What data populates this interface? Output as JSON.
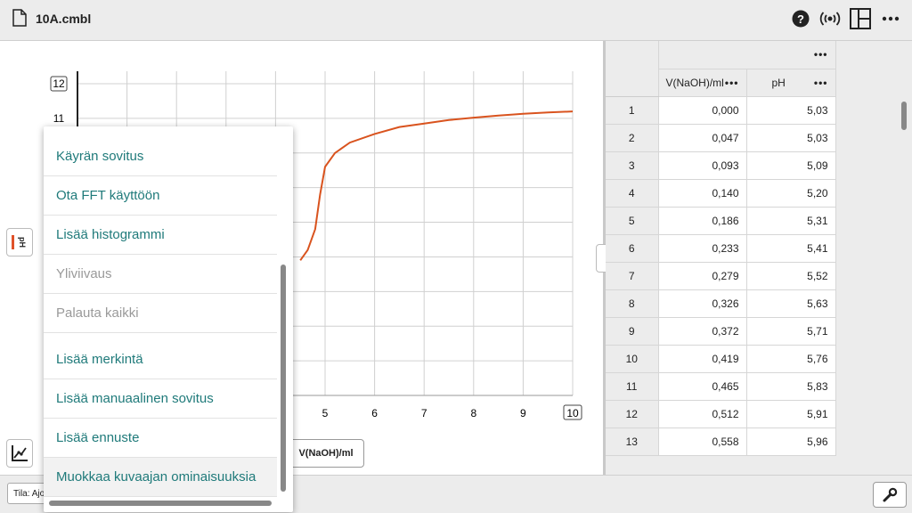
{
  "app": {
    "file_name": "10A.cmbl"
  },
  "toolbar_icons": [
    "file-icon",
    "help-icon",
    "broadcast-icon",
    "layout-icon",
    "more-icon"
  ],
  "graph": {
    "y_axis_button": "pH",
    "x_axis_label": "V(NaOH)/ml",
    "y_ticks": [
      "12",
      "11"
    ],
    "x_ticks": [
      "5",
      "6",
      "7",
      "8",
      "9",
      "10"
    ]
  },
  "chart_data": {
    "type": "line",
    "xlabel": "V(NaOH)/ml",
    "ylabel": "pH",
    "xlim": [
      0,
      10
    ],
    "ylim": [
      3,
      12
    ],
    "series": [
      {
        "x": [
          4.5,
          4.65,
          4.8,
          4.9,
          5.0,
          5.2,
          5.5,
          6.0,
          6.5,
          7.0,
          7.5,
          8.0,
          8.5,
          9.0,
          9.5,
          10.0
        ],
        "y": [
          6.9,
          7.2,
          7.8,
          8.8,
          9.6,
          10.0,
          10.3,
          10.55,
          10.75,
          10.85,
          10.95,
          11.02,
          11.08,
          11.13,
          11.17,
          11.2
        ]
      }
    ],
    "color": "#d9531e",
    "grid": true
  },
  "menu": {
    "items": [
      {
        "label": "Käyrän sovitus",
        "enabled": true
      },
      {
        "label": "Ota FFT käyttöön",
        "enabled": true
      },
      {
        "label": "Lisää histogrammi",
        "enabled": true
      },
      {
        "label": "Yliviivaus",
        "enabled": false
      },
      {
        "label": "Palauta kaikki",
        "enabled": false
      },
      {
        "label": "Lisää merkintä",
        "enabled": true
      },
      {
        "label": "Lisää manuaalinen sovitus",
        "enabled": true
      },
      {
        "label": "Lisää ennuste",
        "enabled": true
      },
      {
        "label": "Muokkaa kuvaajan ominaisuuksia",
        "enabled": true
      }
    ]
  },
  "table": {
    "header_more": "•••",
    "columns": [
      {
        "name": "V(NaOH)/ml",
        "more": "•••"
      },
      {
        "name": "pH",
        "more": "•••"
      }
    ],
    "rows": [
      [
        "1",
        "0,000",
        "5,03"
      ],
      [
        "2",
        "0,047",
        "5,03"
      ],
      [
        "3",
        "0,093",
        "5,09"
      ],
      [
        "4",
        "0,140",
        "5,20"
      ],
      [
        "5",
        "0,186",
        "5,31"
      ],
      [
        "6",
        "0,233",
        "5,41"
      ],
      [
        "7",
        "0,279",
        "5,52"
      ],
      [
        "8",
        "0,326",
        "5,63"
      ],
      [
        "9",
        "0,372",
        "5,71"
      ],
      [
        "10",
        "0,419",
        "5,76"
      ],
      [
        "11",
        "0,465",
        "5,83"
      ],
      [
        "12",
        "0,512",
        "5,91"
      ],
      [
        "13",
        "0,558",
        "5,96"
      ]
    ]
  },
  "status": {
    "label": "Tila: Ajo"
  },
  "colors": {
    "accent": "#1f7a7a",
    "curve": "#d9531e",
    "marker": "#e0522a"
  }
}
